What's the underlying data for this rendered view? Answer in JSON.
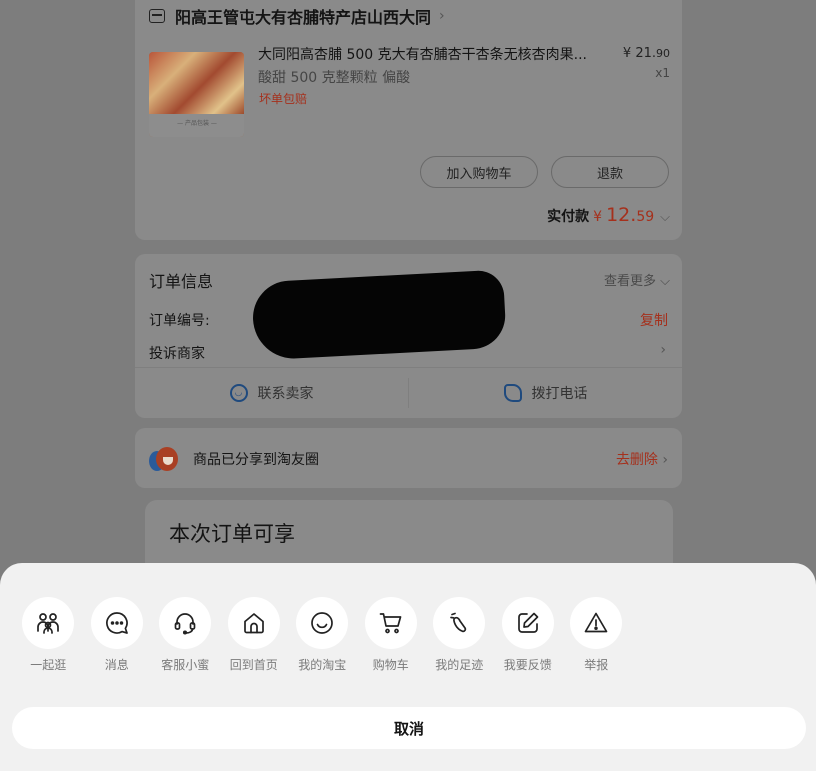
{
  "shop": {
    "name": "阳高王管屯大有杏脯特产店山西大同",
    "chevron": "›"
  },
  "product": {
    "title": "大同阳高杏脯 500 克大有杏脯杏干杏条无核杏肉果...",
    "spec": "酸甜 500 克整颗粒 偏酸",
    "tag": "坏单包赔",
    "price_main": "¥ 21.",
    "price_cents": "90",
    "quantity": "x1",
    "image_caption": "— 产品包装 —"
  },
  "buttons": {
    "add_to_cart": "加入购物车",
    "refund": "退款"
  },
  "payment": {
    "label": "实付款",
    "currency": "¥",
    "amount_main": "12.",
    "amount_cents": "59"
  },
  "order_info": {
    "title": "订单信息",
    "view_more": "查看更多",
    "order_number_label": "订单编号:",
    "copy": "复制",
    "complain_label": "投诉商家",
    "contact_seller": "联系卖家",
    "call_phone": "拨打电话"
  },
  "share": {
    "text": "商品已分享到淘友圈",
    "delete": "去删除"
  },
  "promo": {
    "title": "本次订单可享"
  },
  "sheet": {
    "actions": [
      {
        "label": "一起逛",
        "icon": "group-people-icon"
      },
      {
        "label": "消息",
        "icon": "chat-bubble-icon"
      },
      {
        "label": "客服小蜜",
        "icon": "headset-icon"
      },
      {
        "label": "回到首页",
        "icon": "home-icon"
      },
      {
        "label": "我的淘宝",
        "icon": "smiley-icon"
      },
      {
        "label": "购物车",
        "icon": "cart-icon"
      },
      {
        "label": "我的足迹",
        "icon": "footprint-icon"
      },
      {
        "label": "我要反馈",
        "icon": "feedback-edit-icon"
      },
      {
        "label": "举报",
        "icon": "warning-icon"
      }
    ],
    "cancel": "取消"
  },
  "colors": {
    "accent_red": "#a5301c",
    "link_blue": "#1f4a7e",
    "overlay": "#7d7d7d",
    "sheet_bg": "#f1f1f1"
  }
}
